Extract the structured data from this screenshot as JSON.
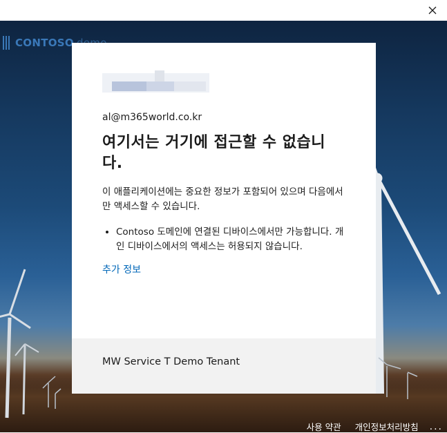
{
  "window": {
    "close_icon": "close-icon"
  },
  "branding": {
    "logo_text": "CONTOSO",
    "logo_suffix": "demo"
  },
  "card": {
    "email": "al@m365world.co.kr",
    "title": "여기서는 거기에 접근할 수 없습니다.",
    "description": "이 애플리케이션에는 중요한 정보가 포함되어 있으며 다음에서만 액세스할 수 있습니다.",
    "bullets": [
      "Contoso 도메인에 연결된 디바이스에서만 가능합니다. 개인 디바이스에서의 액세스는 허용되지 않습니다."
    ],
    "more_info_link": "추가 정보",
    "tenant_name": "MW Service T Demo Tenant"
  },
  "footer": {
    "terms_link": "사용 약관",
    "privacy_link": "개인정보처리방침",
    "more_options": "..."
  },
  "colors": {
    "link": "#0067b8",
    "footer_bg": "#f2f2f2",
    "logo": "#3a78b8"
  }
}
